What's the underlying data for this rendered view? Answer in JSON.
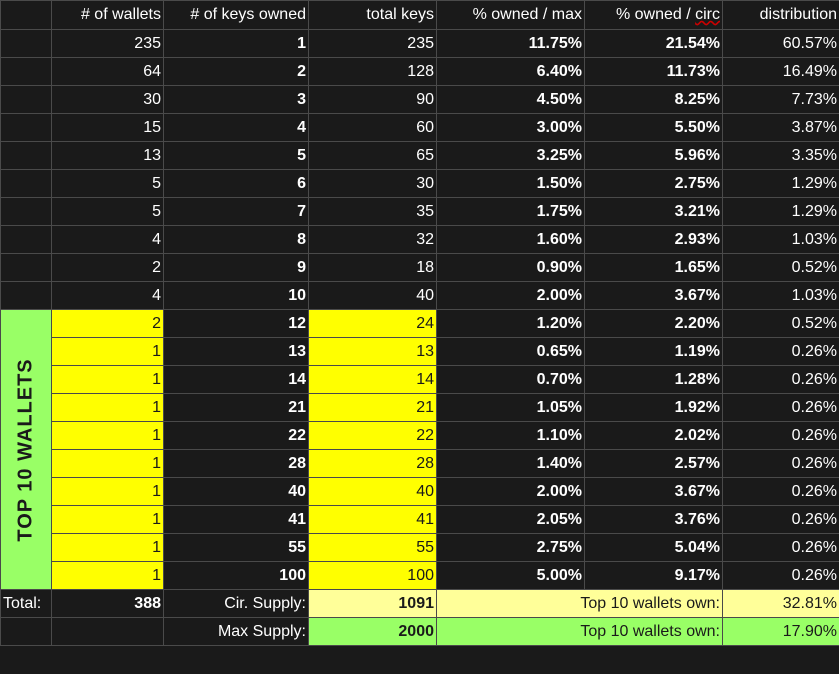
{
  "headers": [
    "# of wallets",
    "# of keys owned",
    "total keys",
    "% owned / max",
    "% owned / circ",
    "distribution"
  ],
  "rows": [
    {
      "wallets": "235",
      "keys": "1",
      "total": "235",
      "pmax": "11.75%",
      "pcirc": "21.54%",
      "dist": "60.57%"
    },
    {
      "wallets": "64",
      "keys": "2",
      "total": "128",
      "pmax": "6.40%",
      "pcirc": "11.73%",
      "dist": "16.49%"
    },
    {
      "wallets": "30",
      "keys": "3",
      "total": "90",
      "pmax": "4.50%",
      "pcirc": "8.25%",
      "dist": "7.73%"
    },
    {
      "wallets": "15",
      "keys": "4",
      "total": "60",
      "pmax": "3.00%",
      "pcirc": "5.50%",
      "dist": "3.87%"
    },
    {
      "wallets": "13",
      "keys": "5",
      "total": "65",
      "pmax": "3.25%",
      "pcirc": "5.96%",
      "dist": "3.35%"
    },
    {
      "wallets": "5",
      "keys": "6",
      "total": "30",
      "pmax": "1.50%",
      "pcirc": "2.75%",
      "dist": "1.29%"
    },
    {
      "wallets": "5",
      "keys": "7",
      "total": "35",
      "pmax": "1.75%",
      "pcirc": "3.21%",
      "dist": "1.29%"
    },
    {
      "wallets": "4",
      "keys": "8",
      "total": "32",
      "pmax": "1.60%",
      "pcirc": "2.93%",
      "dist": "1.03%"
    },
    {
      "wallets": "2",
      "keys": "9",
      "total": "18",
      "pmax": "0.90%",
      "pcirc": "1.65%",
      "dist": "0.52%"
    },
    {
      "wallets": "4",
      "keys": "10",
      "total": "40",
      "pmax": "2.00%",
      "pcirc": "3.67%",
      "dist": "1.03%"
    },
    {
      "wallets": "2",
      "keys": "12",
      "total": "24",
      "pmax": "1.20%",
      "pcirc": "2.20%",
      "dist": "0.52%"
    },
    {
      "wallets": "1",
      "keys": "13",
      "total": "13",
      "pmax": "0.65%",
      "pcirc": "1.19%",
      "dist": "0.26%"
    },
    {
      "wallets": "1",
      "keys": "14",
      "total": "14",
      "pmax": "0.70%",
      "pcirc": "1.28%",
      "dist": "0.26%"
    },
    {
      "wallets": "1",
      "keys": "21",
      "total": "21",
      "pmax": "1.05%",
      "pcirc": "1.92%",
      "dist": "0.26%"
    },
    {
      "wallets": "1",
      "keys": "22",
      "total": "22",
      "pmax": "1.10%",
      "pcirc": "2.02%",
      "dist": "0.26%"
    },
    {
      "wallets": "1",
      "keys": "28",
      "total": "28",
      "pmax": "1.40%",
      "pcirc": "2.57%",
      "dist": "0.26%"
    },
    {
      "wallets": "1",
      "keys": "40",
      "total": "40",
      "pmax": "2.00%",
      "pcirc": "3.67%",
      "dist": "0.26%"
    },
    {
      "wallets": "1",
      "keys": "41",
      "total": "41",
      "pmax": "2.05%",
      "pcirc": "3.76%",
      "dist": "0.26%"
    },
    {
      "wallets": "1",
      "keys": "55",
      "total": "55",
      "pmax": "2.75%",
      "pcirc": "5.04%",
      "dist": "0.26%"
    },
    {
      "wallets": "1",
      "keys": "100",
      "total": "100",
      "pmax": "5.00%",
      "pcirc": "9.17%",
      "dist": "0.26%"
    }
  ],
  "top10_label": "TOP 10 WALLETS",
  "summary": {
    "total_label": "Total:",
    "total_wallets": "388",
    "cir_label": "Cir. Supply:",
    "cir_value": "1091",
    "top10_own_label": "Top 10 wallets own:",
    "top10_cir_pct": "32.81%",
    "max_label": "Max Supply:",
    "max_value": "2000",
    "top10_max_pct": "17.90%"
  },
  "colors": {
    "background": "#1a1a1a",
    "highlight_yellow": "#ffff00",
    "light_yellow": "#ffff99",
    "green": "#99ff66",
    "grid": "#4a4a4a"
  }
}
